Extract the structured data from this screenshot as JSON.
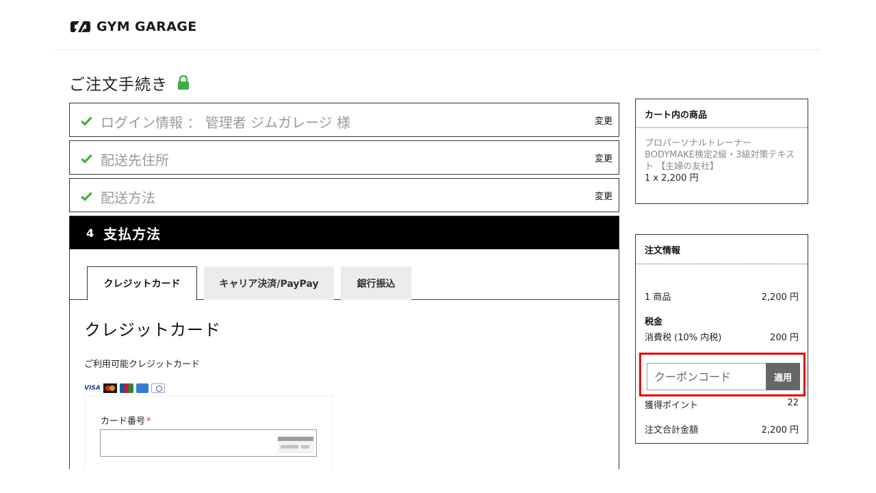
{
  "brand": {
    "name": "GYM GARAGE",
    "icon": "gym-garage-logo"
  },
  "page_title": "ご注文手続き",
  "steps": [
    {
      "label": "ログイン情報 ： 管理者 ジムガレージ 様",
      "action": "変更",
      "done": true
    },
    {
      "label": "配送先住所",
      "action": "変更",
      "done": true
    },
    {
      "label": "配送方法",
      "action": "変更",
      "done": true
    }
  ],
  "payment": {
    "number": "4",
    "title": "支払方法",
    "tabs": [
      "クレジットカード",
      "キャリア決済/PayPay",
      "銀行振込"
    ],
    "active_tab": 0,
    "section_title": "クレジットカード",
    "available_label": "ご利用可能クレジットカード",
    "card_brands": [
      "VISA",
      "Mastercard",
      "JCB",
      "American Express",
      "Diners Club"
    ],
    "card_number_label": "カード番号",
    "required_mark": "*",
    "card_number_value": ""
  },
  "cart": {
    "heading": "カート内の商品",
    "item_name": "プロパーソナルトレーナーBODYMAKE検定2級・3級対策テキスト 【主婦の友社】",
    "item_qty_price": "1 x 2,200 円"
  },
  "order": {
    "heading": "注文情報",
    "items_label": "1 商品",
    "items_value": "2,200 円",
    "tax_heading": "税金",
    "tax_label": "消費税 (10% 内税)",
    "tax_value": "200 円",
    "coupon_placeholder": "クーポンコード",
    "coupon_button": "適用",
    "points_label": "獲得ポイント",
    "points_value": "22",
    "total_label": "注文合計金額",
    "total_value": "2,200 円"
  },
  "colors": {
    "check": "#3cb043",
    "lock": "#3cb043",
    "highlight": "#e00000",
    "header_bg": "#000000",
    "coupon_button": "#666666"
  }
}
